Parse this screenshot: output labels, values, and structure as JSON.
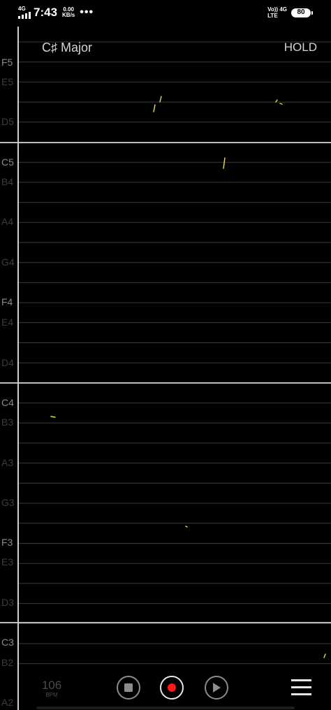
{
  "status_bar": {
    "network": "4G",
    "time": "7:43",
    "speed_value": "0.00",
    "speed_unit": "KB/s",
    "more": "•••",
    "volte_top": "Vo)) 4G",
    "volte_bottom": "LTE",
    "battery": "80"
  },
  "header": {
    "key": "C♯ Major",
    "hold_label": "HOLD"
  },
  "staff": {
    "note_labels": [
      "F5",
      "E5",
      "D5",
      "C5",
      "B4",
      "A4",
      "G4",
      "F4",
      "E4",
      "D4",
      "C4",
      "B3",
      "A3",
      "G3",
      "F3",
      "E3",
      "D3",
      "C3",
      "B2",
      "A2"
    ],
    "bold_notes": [
      "F5",
      "C5",
      "F4",
      "C4",
      "F3",
      "C3"
    ],
    "colors": {
      "line": "#3a3a3a",
      "octave_line": "#bdbdbd",
      "label_dim": "#3c3c3c",
      "label_bold": "#8a8a8a",
      "pitch_trace": "#e8e04a"
    }
  },
  "controls": {
    "tempo_value": "106",
    "tempo_unit": "BPM",
    "stop_icon": "stop-icon",
    "record_icon": "record-icon",
    "play_icon": "play-icon",
    "menu_icon": "menu-icon"
  }
}
